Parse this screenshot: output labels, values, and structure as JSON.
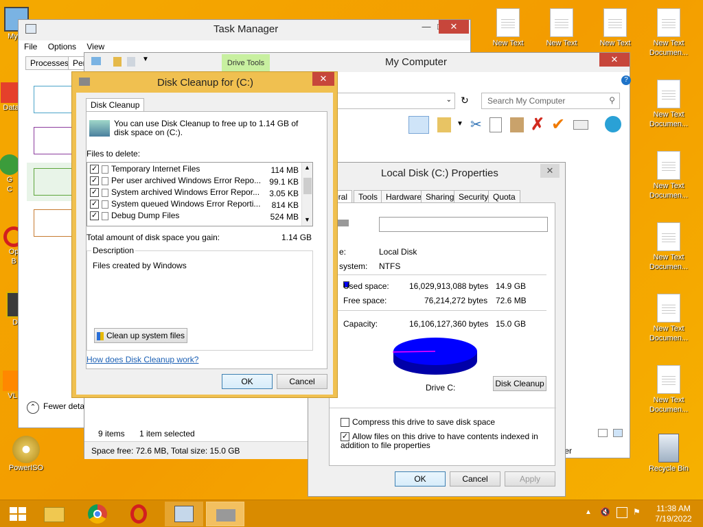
{
  "desktop": {
    "left_icons": [
      "My C",
      "Data",
      "G",
      "C",
      "Op",
      "B",
      "D",
      "VL",
      "PowerISO"
    ],
    "right_icons": [
      "New Text",
      "New Text",
      "New Text",
      "New Text Documen...",
      "New Text Documen...",
      "New Text Documen...",
      "New Text Documen...",
      "New Text Documen...",
      "New Text Documen...",
      "New Text Documen...",
      "Recycle Bin"
    ]
  },
  "task_manager": {
    "title": "Task Manager",
    "menu": [
      "File",
      "Options",
      "View"
    ],
    "tabs": [
      "Processes",
      "Per"
    ],
    "fewer": "Fewer deta"
  },
  "my_computer": {
    "title": "My Computer",
    "drive_tools": "Drive Tools",
    "search_placeholder": "Search My Computer",
    "items": "9 items",
    "selected": "1 item selected",
    "status": "Space free: 72.6 MB, Total size: 15.0 GB",
    "partial": "ter"
  },
  "cleanup": {
    "title": "Disk Cleanup for  (C:)",
    "tab": "Disk Cleanup",
    "intro": "You can use Disk Cleanup to free up to 1.14 GB of disk space on  (C:).",
    "files_label": "Files to delete:",
    "files": [
      {
        "name": "Temporary Internet Files",
        "size": "114 MB"
      },
      {
        "name": "Per user archived Windows Error Repo...",
        "size": "99.1 KB"
      },
      {
        "name": "System archived Windows Error Repor...",
        "size": "3.05 KB"
      },
      {
        "name": "System queued Windows Error Reporti...",
        "size": "814 KB"
      },
      {
        "name": "Debug Dump Files",
        "size": "524 MB"
      }
    ],
    "total_label": "Total amount of disk space you gain:",
    "total_value": "1.14 GB",
    "desc_label": "Description",
    "desc_text": "Files created by Windows",
    "clean_button": "Clean up system files",
    "link": "How does Disk Cleanup work?",
    "ok": "OK",
    "cancel": "Cancel"
  },
  "properties": {
    "title": "Local Disk (C:) Properties",
    "tabs": [
      "eral",
      "Tools",
      "Hardware",
      "Sharing",
      "Security",
      "Quota"
    ],
    "type_label": "e:",
    "type_value": "Local Disk",
    "fs_label": "system:",
    "fs_value": "NTFS",
    "used_label": "Used space:",
    "used_bytes": "16,029,913,088 bytes",
    "used_gb": "14.9 GB",
    "free_label": "Free space:",
    "free_bytes": "76,214,272 bytes",
    "free_gb": "72.6 MB",
    "cap_label": "Capacity:",
    "cap_bytes": "16,106,127,360 bytes",
    "cap_gb": "15.0 GB",
    "drive_label": "Drive C:",
    "cleanup_button": "Disk Cleanup",
    "compress": "Compress this drive to save disk space",
    "index": "Allow files on this drive to have contents indexed in addition to file properties",
    "ok": "OK",
    "cancel": "Cancel",
    "apply": "Apply",
    "used_color": "#0000ff",
    "free_color": "#ff00ff"
  },
  "taskbar": {
    "time": "11:38 AM",
    "date": "7/19/2022"
  }
}
